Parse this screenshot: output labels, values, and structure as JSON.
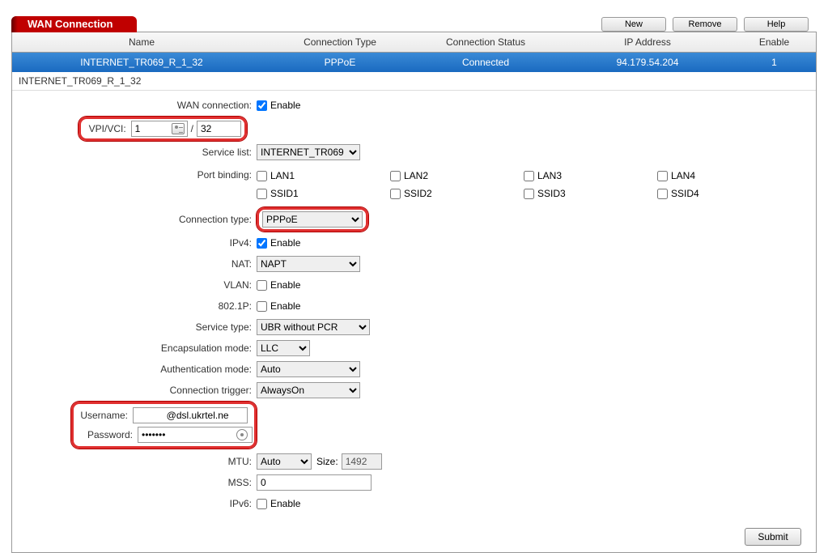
{
  "titlebar": {
    "title": "WAN Connection",
    "buttons": {
      "new": "New",
      "remove": "Remove",
      "help": "Help"
    }
  },
  "columns": {
    "name": "Name",
    "ctype": "Connection Type",
    "status": "Connection Status",
    "ip": "IP Address",
    "enable": "Enable"
  },
  "row": {
    "name": "INTERNET_TR069_R_1_32",
    "ctype": "PPPoE",
    "status": "Connected",
    "ip": "94.179.54.204",
    "enable": "1"
  },
  "section_label": "INTERNET_TR069_R_1_32",
  "labels": {
    "wan_conn": "WAN connection:",
    "enable": "Enable",
    "vpivci": "VPI/VCI:",
    "service_list": "Service list:",
    "port_binding": "Port binding:",
    "conn_type": "Connection type:",
    "ipv4": "IPv4:",
    "nat": "NAT:",
    "vlan": "VLAN:",
    "dot1p": "802.1P:",
    "service_type": "Service type:",
    "encap": "Encapsulation mode:",
    "auth": "Authentication mode:",
    "trigger": "Connection trigger:",
    "username": "Username:",
    "password": "Password:",
    "mtu": "MTU:",
    "size": "Size:",
    "mss": "MSS:",
    "ipv6": "IPv6:"
  },
  "values": {
    "vpi": "1",
    "vci": "32",
    "service_list": "INTERNET_TR069",
    "conn_type": "PPPoE",
    "nat": "NAPT",
    "service_type": "UBR without PCR",
    "encap": "LLC",
    "auth": "Auto",
    "trigger": "AlwaysOn",
    "username": "           @dsl.ukrtel.ne",
    "password": "•••••••",
    "mtu": "Auto",
    "mtu_size": "1492",
    "mss": "0"
  },
  "ports": {
    "lan1": "LAN1",
    "lan2": "LAN2",
    "lan3": "LAN3",
    "lan4": "LAN4",
    "ssid1": "SSID1",
    "ssid2": "SSID2",
    "ssid3": "SSID3",
    "ssid4": "SSID4"
  },
  "submit": "Submit"
}
